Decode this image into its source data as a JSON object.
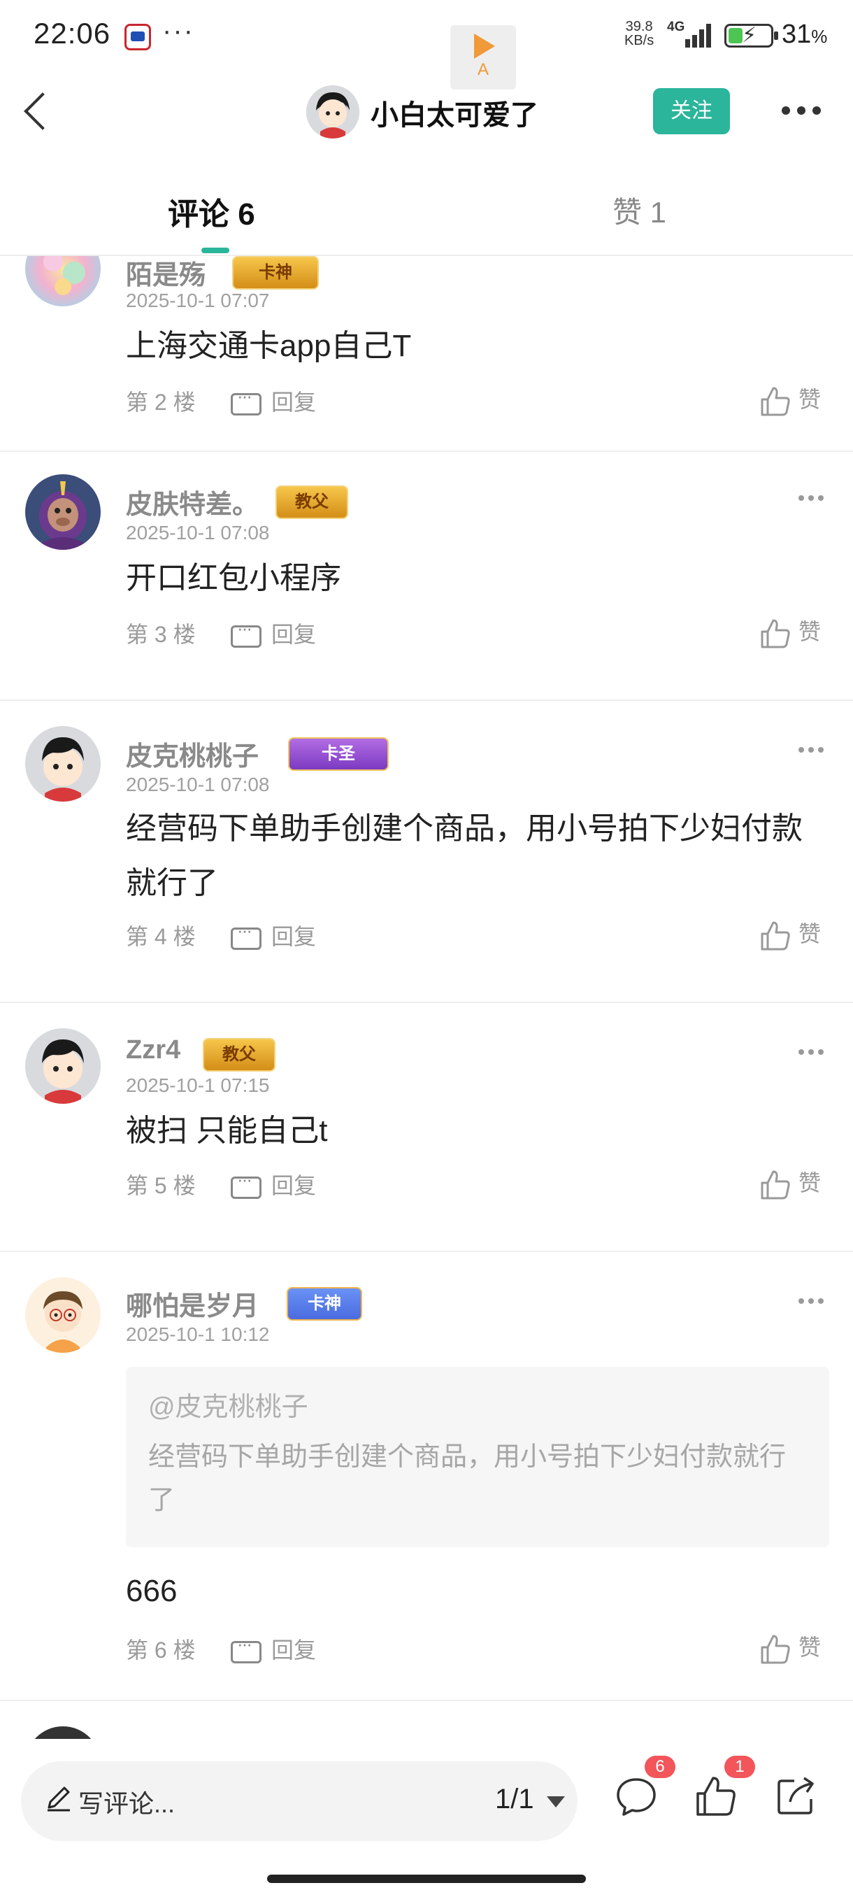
{
  "status_bar": {
    "time": "22:06",
    "more": "···",
    "media_label": "A",
    "net_speed_value": "39.8",
    "net_speed_unit": "KB/s",
    "network": "4G",
    "battery_level": 0.31,
    "battery_text": "31",
    "battery_unit": "%"
  },
  "nav": {
    "title": "小白太可爱了",
    "follow_label": "关注"
  },
  "tabs": [
    {
      "label": "评论 6",
      "active": true
    },
    {
      "label": "赞 1",
      "active": false
    }
  ],
  "comments": [
    {
      "username": "陌是殇",
      "badge": "卡神",
      "time": "2025-10-1 07:07",
      "text": "上海交通卡app自己T",
      "floor": "第 2 楼",
      "reply_label": "回复",
      "like_label": "赞"
    },
    {
      "username": "皮肤特差。",
      "badge": "教父",
      "time": "2025-10-1 07:08",
      "text": "开口红包小程序",
      "floor": "第 3 楼",
      "reply_label": "回复",
      "like_label": "赞"
    },
    {
      "username": "皮克桃桃子",
      "badge": "卡圣",
      "time": "2025-10-1 07:08",
      "text": "经营码下单助手创建个商品，用小号拍下少妇付款就行了",
      "floor": "第 4 楼",
      "reply_label": "回复",
      "like_label": "赞"
    },
    {
      "username": "Zzr4",
      "badge": "教父",
      "time": "2025-10-1 07:15",
      "text": "被扫 只能自己t",
      "floor": "第 5 楼",
      "reply_label": "回复",
      "like_label": "赞"
    },
    {
      "username": "哪怕是岁月",
      "badge": "卡神",
      "time": "2025-10-1 10:12",
      "quote": {
        "user": "@皮克桃桃子",
        "text": "经营码下单助手创建个商品，用小号拍下少妇付款就行了"
      },
      "text": "666",
      "floor": "第 6 楼",
      "reply_label": "回复",
      "like_label": "赞"
    }
  ],
  "bottom_bar": {
    "write_placeholder": "写评论...",
    "pager": "1/1",
    "comment_count": "6",
    "like_count": "1"
  },
  "colors": {
    "accent": "#2bb59b",
    "badge_red": "#f2555a"
  }
}
